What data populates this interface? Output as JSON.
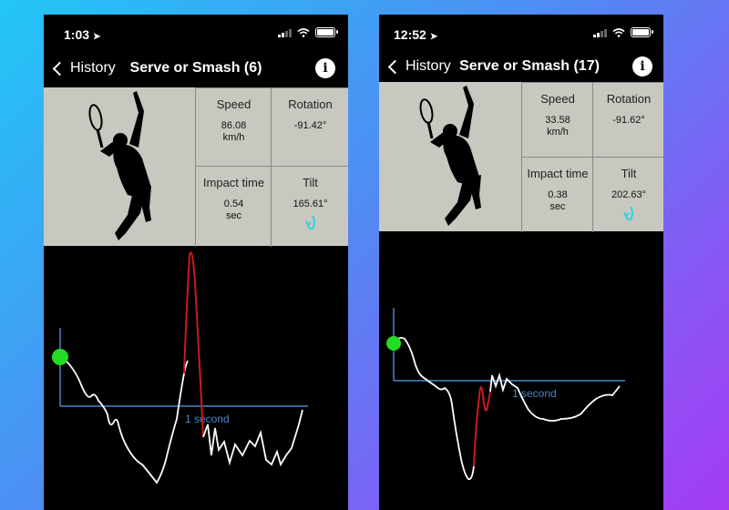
{
  "screens": [
    {
      "status": {
        "time": "1:03"
      },
      "nav": {
        "back_label": "History",
        "title": "Serve or Smash (6)",
        "info_label": "i"
      },
      "stats": {
        "speed": {
          "label": "Speed",
          "value": "86.08",
          "unit": "km/h"
        },
        "rotation": {
          "label": "Rotation",
          "value": "-91.42°"
        },
        "impact": {
          "label": "Impact time",
          "value": "0.54",
          "unit": "sec"
        },
        "tilt": {
          "label": "Tilt",
          "value": "165.61°"
        }
      },
      "graph": {
        "axis_label": "1 second"
      }
    },
    {
      "status": {
        "time": "12:52"
      },
      "nav": {
        "back_label": "History",
        "title": "Serve or Smash (17)",
        "info_label": "i"
      },
      "stats": {
        "speed": {
          "label": "Speed",
          "value": "33.58",
          "unit": "km/h"
        },
        "rotation": {
          "label": "Rotation",
          "value": "-91.62°"
        },
        "impact": {
          "label": "Impact time",
          "value": "0.38",
          "unit": "sec"
        },
        "tilt": {
          "label": "Tilt",
          "value": "202.63°"
        }
      },
      "graph": {
        "axis_label": "1 second"
      }
    }
  ],
  "colors": {
    "panel": "#c8c8c0",
    "trace": "#ffffff",
    "impact_trace": "#cc1b1b",
    "axis": "#4a86c8",
    "start_marker": "#22dd22",
    "tilt_icon": "#2bd3e0"
  },
  "icons": [
    "location-arrow-icon",
    "signal-icon",
    "wifi-icon",
    "battery-icon",
    "chevron-left-icon",
    "info-icon",
    "tennis-player-silhouette",
    "tilt-rotate-icon"
  ]
}
